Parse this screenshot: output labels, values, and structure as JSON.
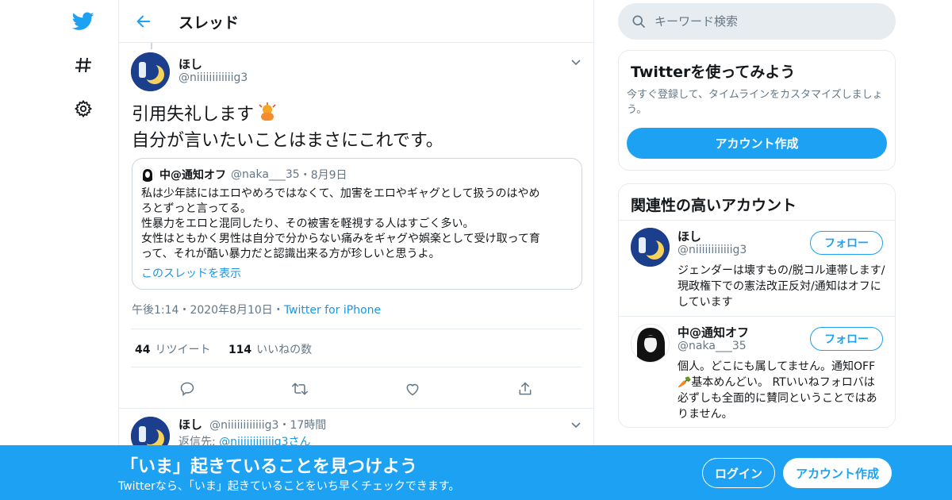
{
  "header": {
    "title": "スレッド"
  },
  "main_tweet": {
    "name": "ほし",
    "handle": "@niiiiiiiiiiiig3",
    "text_line1": "引用失礼します",
    "text_line2": "自分が言いたいことはまさにこれです。",
    "quote": {
      "name": "中@通知オフ",
      "handle": "@naka___35",
      "sep": "・",
      "date": "8月9日",
      "body_lines": [
        "私は少年誌にはエロやめろではなくて、加害をエロやギャグとして扱うのはやめ",
        "ろとずっと言ってる。",
        "性暴力をエロと混同したり、その被害を軽視する人はすごく多い。",
        "女性はともかく男性は自分で分からない痛みをギャグや娯楽として受け取って育",
        "って、それが酷い暴力だと認識出来る方が珍しいと思うよ。"
      ],
      "thread_link": "このスレッドを表示"
    },
    "time": "午後1:14",
    "date": "2020年8月10日",
    "source": "Twitter for iPhone",
    "retweets_count": "44",
    "retweets_label": "リツイート",
    "likes_count": "114",
    "likes_label": "いいねの数"
  },
  "reply_tweet": {
    "name": "ほし",
    "handle": "@niiiiiiiiiiiig3",
    "time": "17時間",
    "reply_prefix": "返信先: ",
    "reply_to": "@niiiiiiiiiiiig3",
    "reply_suffix": "さん"
  },
  "search": {
    "placeholder": "キーワード検索"
  },
  "signup_card": {
    "title": "Twitterを使ってみよう",
    "desc": "今すぐ登録して、タイムラインをカスタマイズしましょう。",
    "button": "アカウント作成"
  },
  "related": {
    "title": "関連性の高いアカウント",
    "accounts": [
      {
        "name": "ほし",
        "handle": "@niiiiiiiiiiiig3",
        "follow": "フォロー",
        "bio": "ジェンダーは壊すもの/脱コル連帯します/現政権下での憲法改正反対/通知はオフにしています"
      },
      {
        "name": "中@通知オフ",
        "handle": "@naka___35",
        "follow": "フォロー",
        "bio": "個人。どこにも属してません。通知OFF🥕基本めんどい。 RTいいねフォロバは必ずしも全面的に賛同ということではありません。"
      }
    ]
  },
  "bottom_bar": {
    "title": "「いま」起きていることを見つけよう",
    "subtitle": "Twitterなら、「いま」起きていることをいち早くチェックできます。",
    "login": "ログイン",
    "signup": "アカウント作成"
  },
  "colors": {
    "brand": "#1da1f2",
    "link": "#1b95e0",
    "muted": "#657786"
  },
  "icons": [
    "twitter-bird-icon",
    "hashtag-icon",
    "gear-icon",
    "back-arrow-icon",
    "chevron-down-icon",
    "reply-icon",
    "retweet-icon",
    "like-icon",
    "share-icon",
    "search-icon"
  ]
}
